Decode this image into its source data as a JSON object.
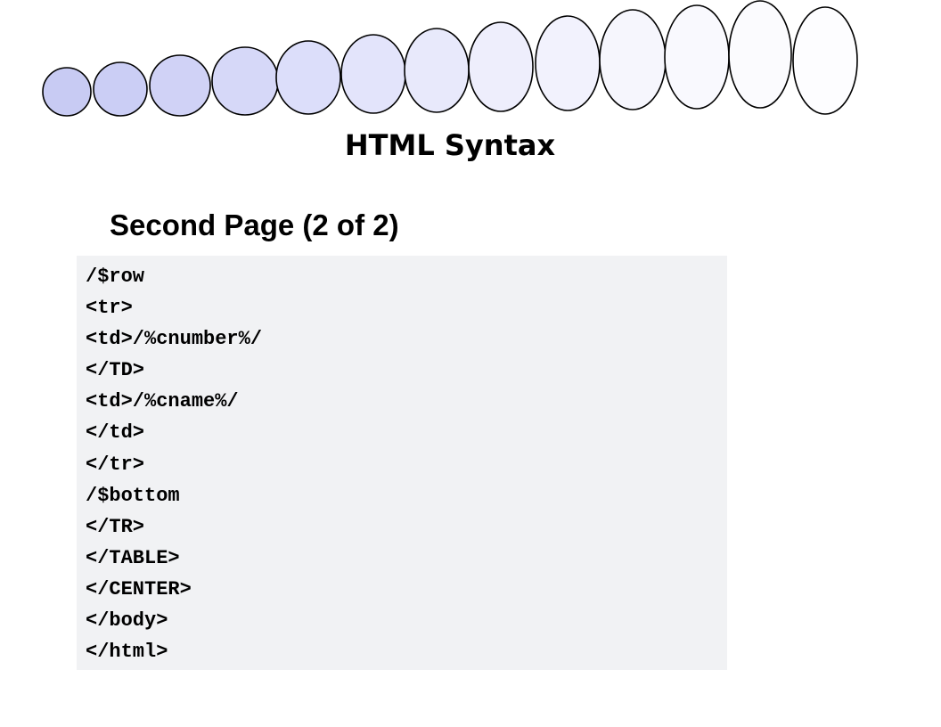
{
  "header": {
    "decoration": "oval-chain",
    "oval_colors": [
      "#c8cbf3",
      "#cbcef5",
      "#d0d2f6",
      "#d6d8f8",
      "#dcdefa",
      "#e3e4fb",
      "#e8e9fb",
      "#eeeefc",
      "#f2f2fd",
      "#f6f6fd",
      "#f9f9fe",
      "#fbfbfe",
      "#fdfdff"
    ]
  },
  "slide": {
    "title": "HTML Syntax",
    "subtitle": "Second Page (2 of 2)"
  },
  "code": {
    "lines": [
      "/$row",
      "<tr>",
      "<td>/%cnumber%/",
      "</TD>",
      "<td>/%cname%/",
      "</td>",
      "</tr>",
      "/$bottom",
      "</TR>",
      "</TABLE>",
      "</CENTER>",
      "</body>",
      "</html>"
    ]
  }
}
